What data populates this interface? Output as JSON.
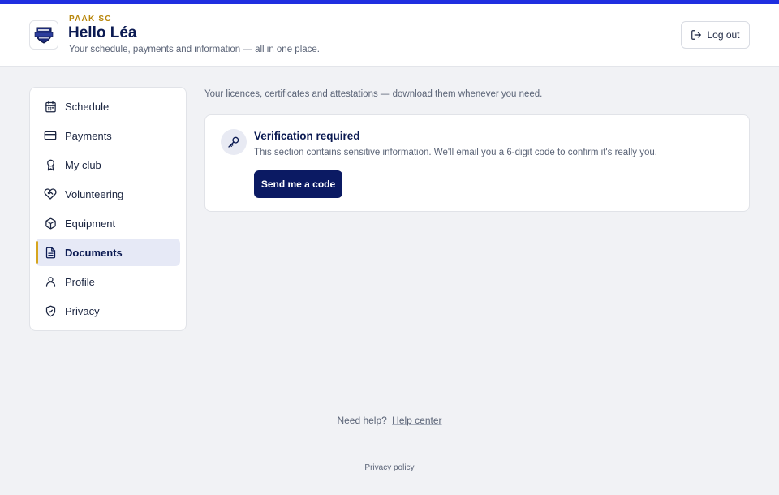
{
  "header": {
    "club_name": "PAAK SC",
    "greeting": "Hello Léa",
    "subtitle": "Your schedule, payments and information — all in one place.",
    "logout_label": "Log out"
  },
  "sidebar": {
    "items": [
      {
        "label": "Schedule",
        "icon": "calendar-icon"
      },
      {
        "label": "Payments",
        "icon": "credit-card-icon"
      },
      {
        "label": "My club",
        "icon": "award-icon"
      },
      {
        "label": "Volunteering",
        "icon": "handshake-heart-icon"
      },
      {
        "label": "Equipment",
        "icon": "box-icon"
      },
      {
        "label": "Documents",
        "icon": "document-icon",
        "active": true
      },
      {
        "label": "Profile",
        "icon": "user-icon"
      },
      {
        "label": "Privacy",
        "icon": "shield-check-icon"
      }
    ]
  },
  "main": {
    "intro": "Your licences, certificates and attestations — download them whenever you need.",
    "verification": {
      "title": "Verification required",
      "description": "This section contains sensitive information. We'll email you a 6-digit code to confirm it's really you.",
      "button_label": "Send me a code"
    }
  },
  "footer": {
    "help_prefix": "Need help?",
    "help_link": "Help center",
    "privacy_link": "Privacy policy"
  },
  "colors": {
    "accent": "#1f2ee0",
    "primary": "#0b1a63",
    "active_marker": "#d6a51e",
    "club_name": "#b8860b"
  }
}
